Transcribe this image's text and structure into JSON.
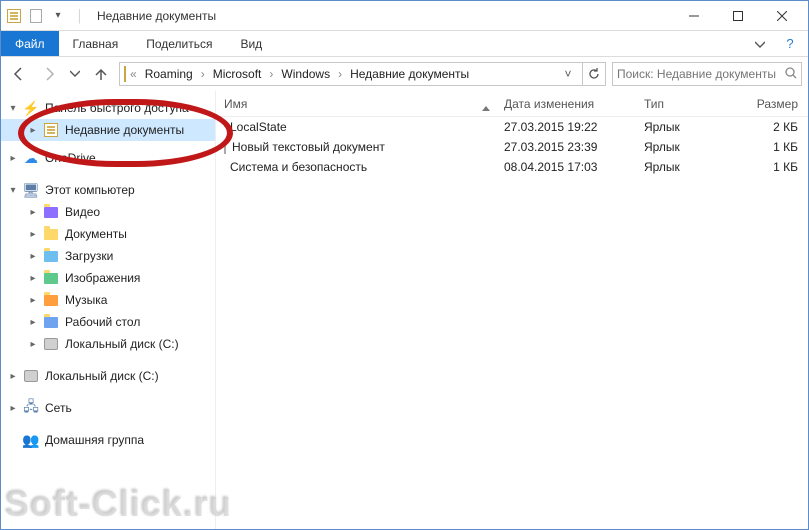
{
  "title": "Недавние документы",
  "ribbon": {
    "file": "Файл",
    "tabs": [
      "Главная",
      "Поделиться",
      "Вид"
    ]
  },
  "breadcrumbs": [
    "Roaming",
    "Microsoft",
    "Windows",
    "Недавние документы"
  ],
  "search_placeholder": "Поиск: Недавние документы",
  "columns": {
    "name": "Имя",
    "date": "Дата изменения",
    "type": "Тип",
    "size": "Размер"
  },
  "sidebar": {
    "quick": "Панель быстрого доступа",
    "recent": "Недавние документы",
    "onedrive": "OneDrive",
    "thispc": "Этот компьютер",
    "video": "Видео",
    "documents": "Документы",
    "downloads": "Загрузки",
    "pictures": "Изображения",
    "music": "Музыка",
    "desktop": "Рабочий стол",
    "disk_c": "Локальный диск (C:)",
    "disk_c2": "Локальный диск (C:)",
    "network": "Сеть",
    "homegroup": "Домашняя группа"
  },
  "files": [
    {
      "name": "LocalState",
      "date": "27.03.2015 19:22",
      "type": "Ярлык",
      "size": "2 КБ",
      "icon": "folder"
    },
    {
      "name": "Новый текстовый документ",
      "date": "27.03.2015 23:39",
      "type": "Ярлык",
      "size": "1 КБ",
      "icon": "file"
    },
    {
      "name": "Система и безопасность",
      "date": "08.04.2015 17:03",
      "type": "Ярлык",
      "size": "1 КБ",
      "icon": "globe"
    }
  ],
  "watermark": "Soft-Click.ru"
}
